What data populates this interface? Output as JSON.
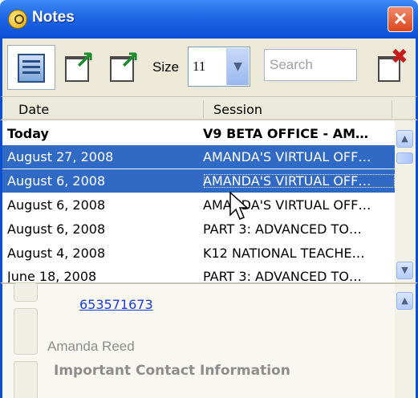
{
  "window": {
    "title": "Notes",
    "close_label": "✕"
  },
  "toolbar": {
    "size_label": "Size",
    "size_value": "11",
    "search_placeholder": "Search"
  },
  "grid": {
    "columns": {
      "date": "Date",
      "session": "Session"
    },
    "rows": [
      {
        "date": "Today",
        "session": "V9 BETA OFFICE - AM…",
        "state": "bold"
      },
      {
        "date": "August 27, 2008",
        "session": "AMANDA'S VIRTUAL OFF…",
        "state": "selected"
      },
      {
        "date": "August 6, 2008",
        "session": "AMANDA'S VIRTUAL OFF…",
        "state": "selected"
      },
      {
        "date": "August 6, 2008",
        "session": "AMANDA'S VIRTUAL OFF…",
        "state": "normal"
      },
      {
        "date": "August 6, 2008",
        "session": "PART 3: ADVANCED TO…",
        "state": "normal"
      },
      {
        "date": "August 4, 2008",
        "session": "K12 NATIONAL TEACHE…",
        "state": "normal"
      },
      {
        "date": "June 18, 2008",
        "session": "PART 3: ADVANCED TO…",
        "state": "normal"
      }
    ]
  },
  "details": {
    "phone": "653571673",
    "name": "Amanda Reed",
    "heading": "Important Contact Information"
  },
  "colors": {
    "title_bar": "#1f66e5",
    "selection": "#316ac5",
    "link": "#1a3cd6",
    "close": "#d9461f"
  }
}
